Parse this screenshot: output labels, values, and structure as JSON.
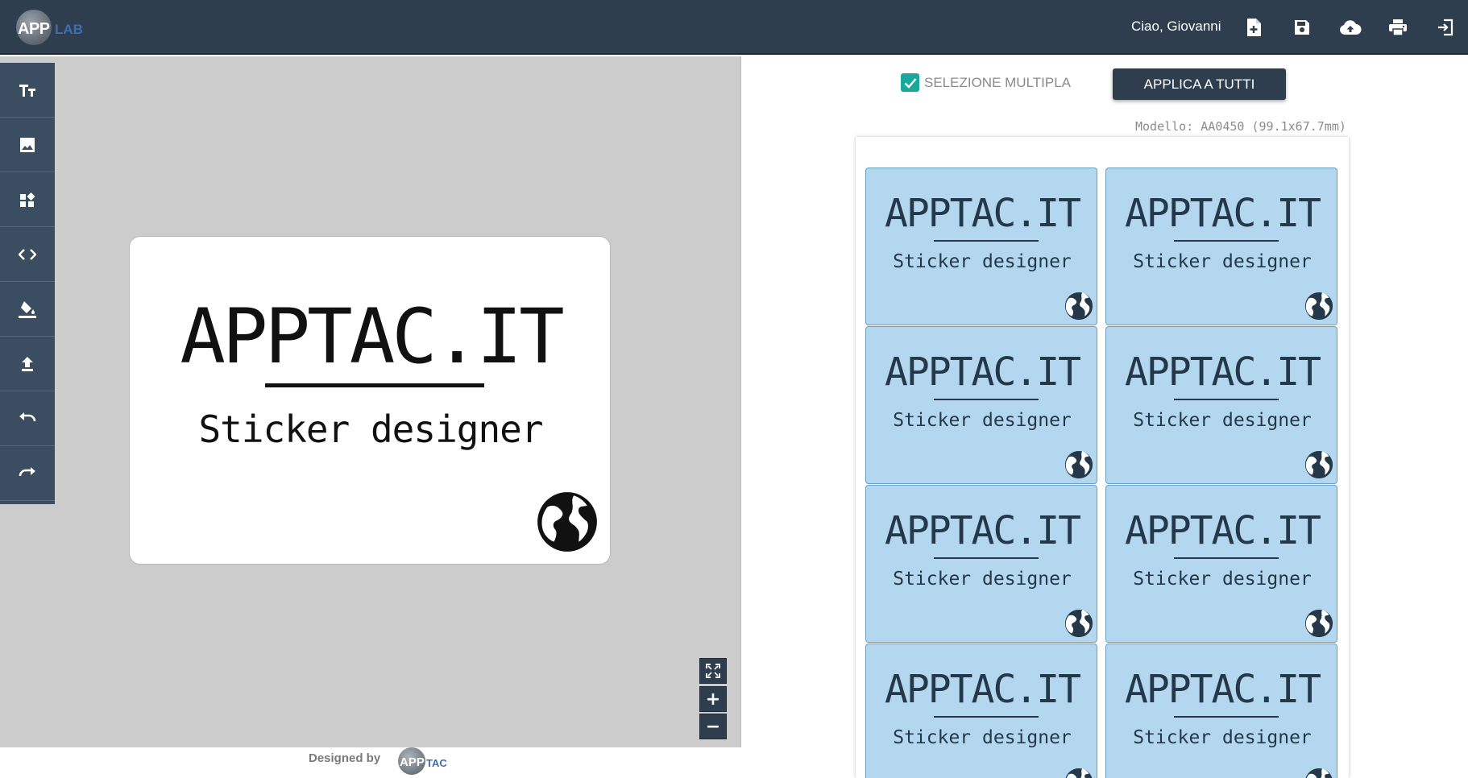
{
  "header": {
    "logo_app": "APP",
    "logo_lab": "LAB",
    "greeting": "Ciao, Giovanni",
    "icons": [
      "new-document-icon",
      "save-icon",
      "cloud-upload-icon",
      "print-icon",
      "logout-icon"
    ]
  },
  "toolbar": {
    "tools": [
      "text-icon",
      "image-icon",
      "widgets-icon",
      "code-icon",
      "fill-color-icon",
      "upload-icon",
      "undo-icon",
      "redo-icon"
    ]
  },
  "editor": {
    "sticker": {
      "title": "APPTAC.IT",
      "subtitle": "Sticker designer",
      "icon": "globe-icon"
    },
    "zoom": {
      "fit": "fullscreen-icon",
      "in": "+",
      "out": "−"
    }
  },
  "footer": {
    "designed_by": "Designed by",
    "logo_app": "APP",
    "logo_tac": "TAC"
  },
  "panel": {
    "multi_select_label": "SELEZIONE MULTIPLA",
    "multi_select_checked": true,
    "apply_button": "APPLICA A TUTTI",
    "model_info": "Modello: AA0450 (99.1x67.7mm)"
  },
  "sheet": {
    "label_color": "#b3d7ef",
    "labels": [
      {
        "title": "APPTAC.IT",
        "subtitle": "Sticker designer"
      },
      {
        "title": "APPTAC.IT",
        "subtitle": "Sticker designer"
      },
      {
        "title": "APPTAC.IT",
        "subtitle": "Sticker designer"
      },
      {
        "title": "APPTAC.IT",
        "subtitle": "Sticker designer"
      },
      {
        "title": "APPTAC.IT",
        "subtitle": "Sticker designer"
      },
      {
        "title": "APPTAC.IT",
        "subtitle": "Sticker designer"
      },
      {
        "title": "APPTAC.IT",
        "subtitle": "Sticker designer"
      },
      {
        "title": "APPTAC.IT",
        "subtitle": "Sticker designer"
      }
    ]
  },
  "colors": {
    "header_bg": "#2e3e4f",
    "toolbar_bg": "#3b4e61",
    "canvas_bg": "#cccccc",
    "accent_teal": "#1aa89c"
  }
}
